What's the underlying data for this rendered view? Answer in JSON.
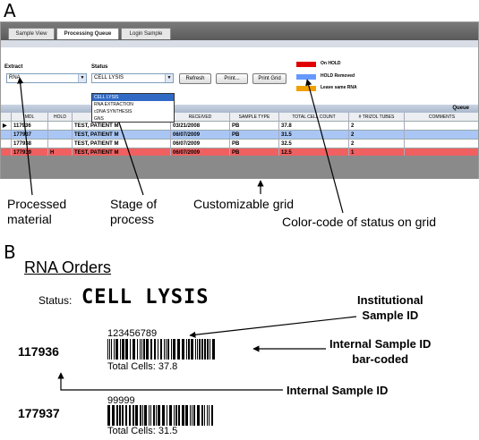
{
  "panels": {
    "a": "A",
    "b": "B"
  },
  "app": {
    "tabs": [
      "Sample View",
      "Processing Queue",
      "Login Sample"
    ],
    "extract": {
      "label": "Extract",
      "value": "RNA"
    },
    "status": {
      "label": "Status",
      "value": "CELL LYSIS",
      "options": [
        "CELL LYSIS",
        "RNA EXTRACTION",
        "cDNA SYNTHESIS",
        "GNS"
      ]
    },
    "buttons": {
      "refresh": "Refresh",
      "print": "Print...",
      "print_grid": "Print Grid"
    },
    "legend": [
      {
        "label": "On HOLD",
        "color": "#e00000"
      },
      {
        "label": "HOLD Removed",
        "color": "#6699ff"
      },
      {
        "label": "Leave same RNA",
        "color": "#f0a000"
      }
    ],
    "queue_label": "Queue",
    "grid": {
      "columns": [
        "MDL",
        "HOLD",
        "",
        "RECEIVED",
        "SAMPLE TYPE",
        "TOTAL CELL COUNT",
        "# TRIZOL TUBES",
        "COMMENTS"
      ],
      "rows": [
        {
          "mdl": "117936",
          "hold": "",
          "name": "TEST, PATIENT M",
          "received": "03/21/2008",
          "type": "PB",
          "count": "37.8",
          "tubes": "2",
          "comments": "",
          "color": "#ffffff",
          "pointer": "▶"
        },
        {
          "mdl": "177937",
          "hold": "",
          "name": "TEST, PATIENT M",
          "received": "06/07/2009",
          "type": "PB",
          "count": "31.5",
          "tubes": "2",
          "comments": "",
          "color": "#a9c6f5",
          "pointer": ""
        },
        {
          "mdl": "177938",
          "hold": "",
          "name": "TEST, PATIENT M",
          "received": "06/07/2009",
          "type": "PB",
          "count": "32.5",
          "tubes": "2",
          "comments": "",
          "color": "#ffffff",
          "pointer": ""
        },
        {
          "mdl": "177939",
          "hold": "H",
          "name": "TEST, PATIENT M",
          "received": "06/07/2009",
          "type": "PB",
          "count": "12.5",
          "tubes": "1",
          "comments": "",
          "color": "#f06060",
          "pointer": ""
        }
      ]
    }
  },
  "callouts": {
    "processed": [
      "Processed",
      "material"
    ],
    "stage": [
      "Stage of",
      "process"
    ],
    "grid": "Customizable grid",
    "color": "Color-code of status on grid",
    "inst": [
      "Institutional",
      "Sample ID"
    ],
    "internal_bc": [
      "Internal Sample ID",
      "bar-coded"
    ],
    "internal": "Internal Sample ID"
  },
  "orders": {
    "title": "RNA Orders",
    "status_label": "Status:",
    "status_value": "CELL LYSIS",
    "items": [
      {
        "id": "117936",
        "inst_id": "123456789",
        "cells_label": "Total Cells:",
        "cells_value": "37.8"
      },
      {
        "id": "177937",
        "inst_id": "99999",
        "cells_label": "Total Cells:",
        "cells_value": "31.5"
      }
    ]
  }
}
